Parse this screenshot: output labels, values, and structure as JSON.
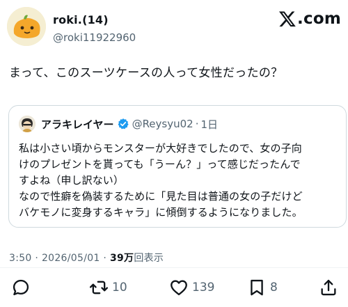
{
  "author": {
    "name": "roki.(14)",
    "handle": "@roki11922960"
  },
  "brand": {
    "name": "X.com",
    "suffix": ".com"
  },
  "tweet": {
    "text": "まって、このスーツケースの人って女性だったの？"
  },
  "quote": {
    "name": "アラキレイヤー",
    "handle": "@Reysyu02",
    "separator": "·",
    "time": "1日",
    "lines": [
      "私は小さい頃からモンスターが大好きでしたので、女の子向",
      "けのプレゼントを貰っても「うーん？」って感じだったんで",
      "すよね（申し訳ない）",
      "なので性癖を偽装するために「見た目は普通の女の子だけど",
      "バケモノに変身するキャラ」に傾倒するようになりました。"
    ]
  },
  "meta": {
    "time": "3:50",
    "separator1": "·",
    "date": "2026/05/01",
    "separator2": "·",
    "views_count": "39万",
    "views_label": "回表示"
  },
  "actions": {
    "reply": {
      "icon": "reply-icon",
      "count": ""
    },
    "retweet": {
      "icon": "retweet-icon",
      "count": "10"
    },
    "like": {
      "icon": "heart-icon",
      "count": "139"
    },
    "bookmark": {
      "icon": "bookmark-icon",
      "count": "8"
    },
    "share": {
      "icon": "share-icon",
      "count": ""
    }
  },
  "colors": {
    "text": "#0f1419",
    "secondary": "#536471",
    "border": "#cfd9de",
    "verified": "#1d9bf0"
  }
}
